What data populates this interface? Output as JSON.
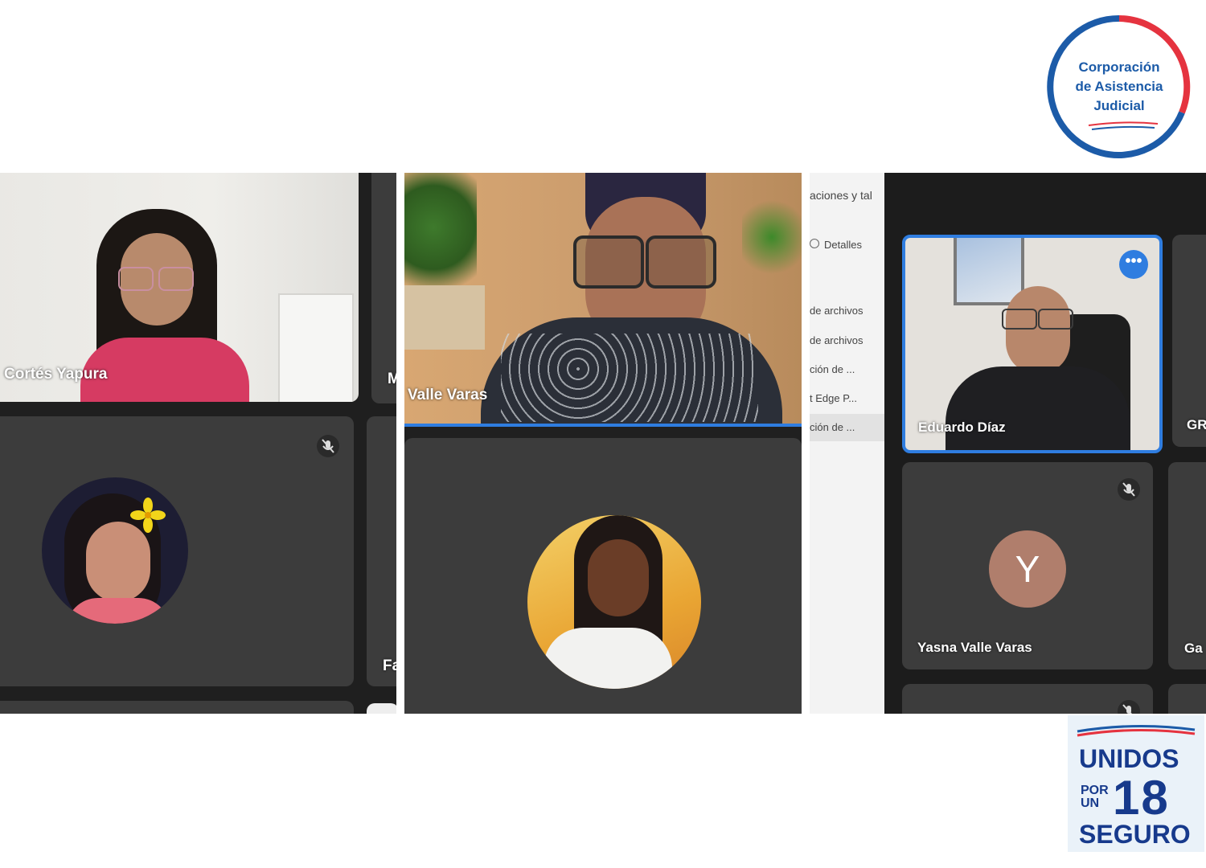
{
  "logo": {
    "line1": "Corporación",
    "line2": "de Asistencia",
    "line3": "Judicial"
  },
  "panel1": {
    "tile_top_name": "Cortés Yapura",
    "tile_right_name_partial": "M",
    "tile_bottom_right_name_partial": "Fa"
  },
  "panel2": {
    "tile_top_name": "Valle Varas"
  },
  "panel3": {
    "sidebar": {
      "items": [
        "aciones y tal",
        "Detalles",
        "de archivos",
        "de archivos",
        "ción de ...",
        "t Edge P...",
        "ción de ..."
      ]
    },
    "tile_main_name": "Eduardo Díaz",
    "tile_right_name_partial": "GR",
    "avatar_letter": "Y",
    "tile_avatar_name": "Yasna Valle Varas",
    "tile_right2_name_partial": "Ga"
  },
  "bottom_logo": {
    "line1": "UNIDOS",
    "por": "POR",
    "un": "UN",
    "number": "18",
    "line3": "SEGURO"
  },
  "colors": {
    "tile_bg": "#3c3c3c",
    "active_border": "#2f7de0",
    "logo_red": "#e5333f",
    "logo_blue": "#1c5ba8",
    "unidos_blue": "#173a8c",
    "avatar_bg": "#b07e6c"
  }
}
